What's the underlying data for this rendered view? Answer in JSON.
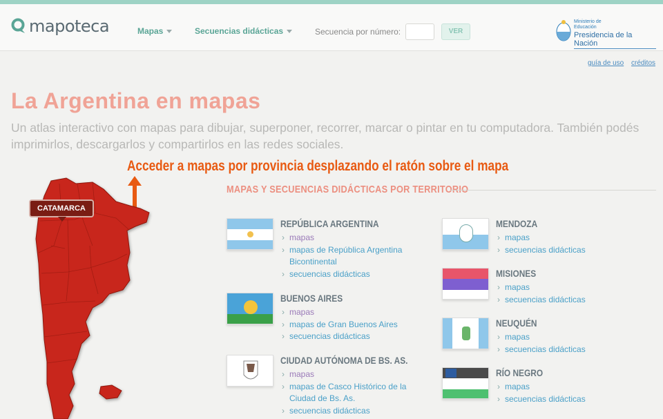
{
  "header": {
    "logo_text": "mapoteca",
    "nav": [
      {
        "label": "Mapas"
      },
      {
        "label": "Secuencias didácticas"
      }
    ],
    "sequence_label": "Secuencia por número:",
    "sequence_value": "",
    "ver_label": "VER",
    "ministry_top": "Ministerio de Educación",
    "ministry_bottom": "Presidencia de la Nación"
  },
  "links": {
    "usage": "guía de uso",
    "credits": "créditos"
  },
  "hero": {
    "title": "La Argentina en mapas",
    "subtitle": "Un atlas interactivo con mapas para dibujar, superponer, recorrer, marcar o pintar en tu computadora. También podés imprimirlos, descargarlos y compartirlos en las redes sociales."
  },
  "hint": "Acceder a mapas por provincia desplazando el ratón sobre el mapa",
  "map": {
    "tooltip": "CATAMARCA",
    "fill_color": "#c8281a"
  },
  "section_title": "MAPAS Y SECUENCIAS DIDÁCTICAS POR TERRITORIO",
  "provinces_left": [
    {
      "name": "REPÚBLICA ARGENTINA",
      "links": [
        "mapas",
        "mapas de República Argentina Bicontinental",
        "secuencias didácticas"
      ]
    },
    {
      "name": "BUENOS AIRES",
      "links": [
        "mapas",
        "mapas de Gran Buenos Aires",
        "secuencias didácticas"
      ]
    },
    {
      "name": "CIUDAD AUTÓNOMA DE BS. AS.",
      "links": [
        "mapas",
        "mapas de Casco Histórico de la Ciudad de Bs. As.",
        "secuencias didácticas"
      ]
    }
  ],
  "provinces_right": [
    {
      "name": "MENDOZA",
      "links": [
        "mapas",
        "secuencias didácticas"
      ]
    },
    {
      "name": "MISIONES",
      "links": [
        "mapas",
        "secuencias didácticas"
      ]
    },
    {
      "name": "NEUQUÉN",
      "links": [
        "mapas",
        "secuencias didácticas"
      ]
    },
    {
      "name": "RÍO NEGRO",
      "links": [
        "mapas",
        "secuencias didácticas"
      ]
    }
  ],
  "colors": {
    "accent": "#5aa596",
    "title": "#f0a396",
    "hint": "#e85a12",
    "link": "#4aa0c8",
    "visited": "#9a7ab8"
  }
}
